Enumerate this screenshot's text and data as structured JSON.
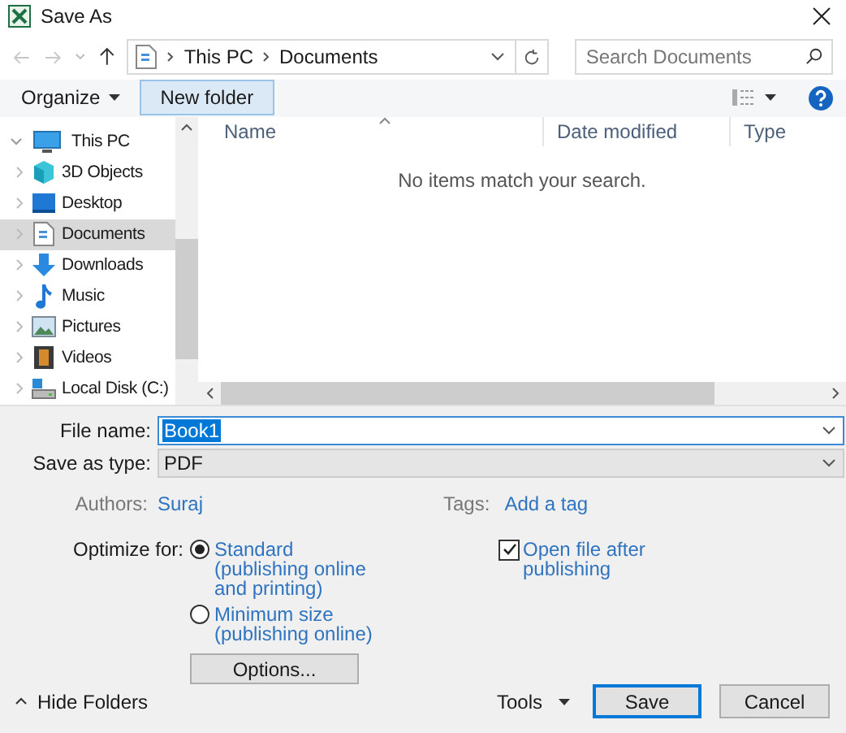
{
  "window": {
    "title": "Save As"
  },
  "address_bar": {
    "path": [
      "This PC",
      "Documents"
    ]
  },
  "search": {
    "placeholder": "Search Documents"
  },
  "toolbar": {
    "organize": "Organize",
    "new_folder": "New folder"
  },
  "navigation": [
    {
      "label": "This PC",
      "expanded": true,
      "selected": false,
      "children": [
        {
          "label": "3D Objects",
          "expanded": false,
          "selected": false
        },
        {
          "label": "Desktop",
          "expanded": false,
          "selected": false
        },
        {
          "label": "Documents",
          "expanded": false,
          "selected": true
        },
        {
          "label": "Downloads",
          "expanded": false,
          "selected": false
        },
        {
          "label": "Music",
          "expanded": false,
          "selected": false
        },
        {
          "label": "Pictures",
          "expanded": false,
          "selected": false
        },
        {
          "label": "Videos",
          "expanded": false,
          "selected": false
        },
        {
          "label": "Local Disk (C:)",
          "expanded": false,
          "selected": false
        }
      ]
    }
  ],
  "columns": [
    "Name",
    "Date modified",
    "Type"
  ],
  "empty_message": "No items match your search.",
  "file_name": {
    "label": "File name:",
    "value": "Book1"
  },
  "save_as_type": {
    "label": "Save as type:",
    "value": "PDF"
  },
  "authors": {
    "label": "Authors:",
    "value": "Suraj"
  },
  "tags": {
    "label": "Tags:",
    "value": "Add a tag"
  },
  "optimize": {
    "label": "Optimize for:",
    "options": [
      {
        "label": "Standard (publishing online and printing)",
        "selected": true
      },
      {
        "label": "Minimum size (publishing online)",
        "selected": false
      }
    ]
  },
  "open_after": {
    "label": "Open file after publishing",
    "checked": true
  },
  "options_button": "Options...",
  "hide_folders": "Hide Folders",
  "tools": "Tools",
  "buttons": {
    "save": "Save",
    "cancel": "Cancel"
  }
}
